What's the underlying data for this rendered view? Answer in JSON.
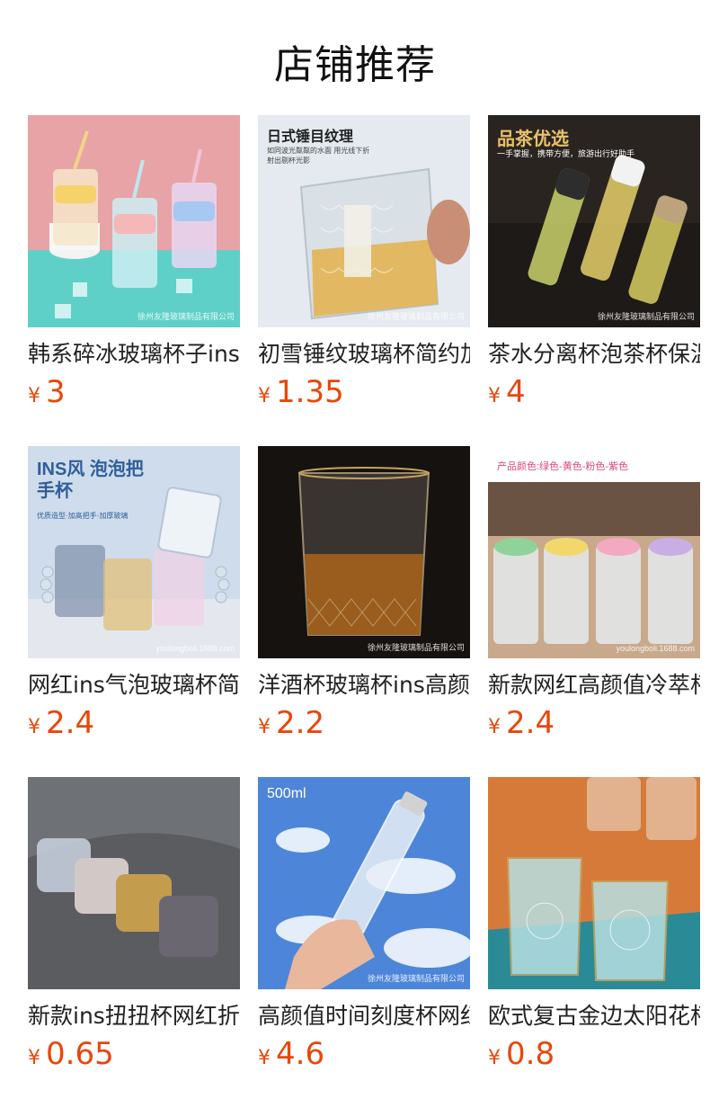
{
  "page": {
    "title": "店铺推荐"
  },
  "products": [
    {
      "name": "韩系碎冰玻璃杯子ins风高颜值",
      "currency": "¥",
      "price": "3",
      "image": "pastel-tumblers-with-straws",
      "bg": "#e9a0a6",
      "overlay_text": "",
      "overlay_sub": "",
      "watermark": "徐州友隆玻璃制品有限公司"
    },
    {
      "name": "初雪锤纹玻璃杯简约加厚",
      "currency": "¥",
      "price": "1.35",
      "image": "hammered-glass-whisky",
      "bg": "#e6ecf2",
      "overlay_text": "日式锤目纹理",
      "overlay_sub": "如同波光粼粼的水面 用光线下折射出剔杯光影",
      "watermark": "徐州友隆玻璃制品有限公司"
    },
    {
      "name": "茶水分离杯泡茶杯保温",
      "currency": "¥",
      "price": "4",
      "image": "tea-separation-bottles",
      "bg": "#2a2320",
      "overlay_text": "品茶优选",
      "overlay_sub": "一手掌握，携带方便，旅游出行好助手",
      "watermark": "徐州友隆玻璃制品有限公司"
    },
    {
      "name": "网红ins气泡玻璃杯简约",
      "currency": "¥",
      "price": "2.4",
      "image": "bubble-handle-mugs",
      "bg": "#c9d9ea",
      "overlay_text": "INS风 泡泡把手杯",
      "overlay_sub": "优质造型·加高把手·加厚玻璃",
      "watermark": "youlongboli.1688.com"
    },
    {
      "name": "洋酒杯玻璃杯ins高颜值",
      "currency": "¥",
      "price": "2.2",
      "image": "whisky-glass-dark",
      "bg": "#141210",
      "overlay_text": "",
      "overlay_sub": "",
      "watermark": "徐州友隆玻璃制品有限公司"
    },
    {
      "name": "新款网红高颜值冷萃杯",
      "currency": "¥",
      "price": "2.4",
      "image": "cartoon-straw-cups",
      "bg": "#d8c4b0",
      "overlay_text": "产品颜色:绿色-黄色-粉色-紫色",
      "overlay_sub": "",
      "watermark": "youlongboli.1688.com"
    },
    {
      "name": "新款ins扭扭杯网红折纹杯",
      "currency": "¥",
      "price": "0.65",
      "image": "twisted-glasses-car",
      "bg": "#6d6f73",
      "overlay_text": "",
      "overlay_sub": "",
      "watermark": ""
    },
    {
      "name": "高颜值时间刻度杯网红",
      "currency": "¥",
      "price": "4.6",
      "image": "bottle-sky",
      "bg": "#4f86d8",
      "overlay_text": "500ml",
      "overlay_sub": "",
      "watermark": "徐州友隆玻璃制品有限公司"
    },
    {
      "name": "欧式复古金边太阳花杯",
      "currency": "¥",
      "price": "0.8",
      "image": "embossed-sunflower-glasses",
      "bg": "#d8793a",
      "overlay_text": "",
      "overlay_sub": "",
      "watermark": ""
    }
  ]
}
